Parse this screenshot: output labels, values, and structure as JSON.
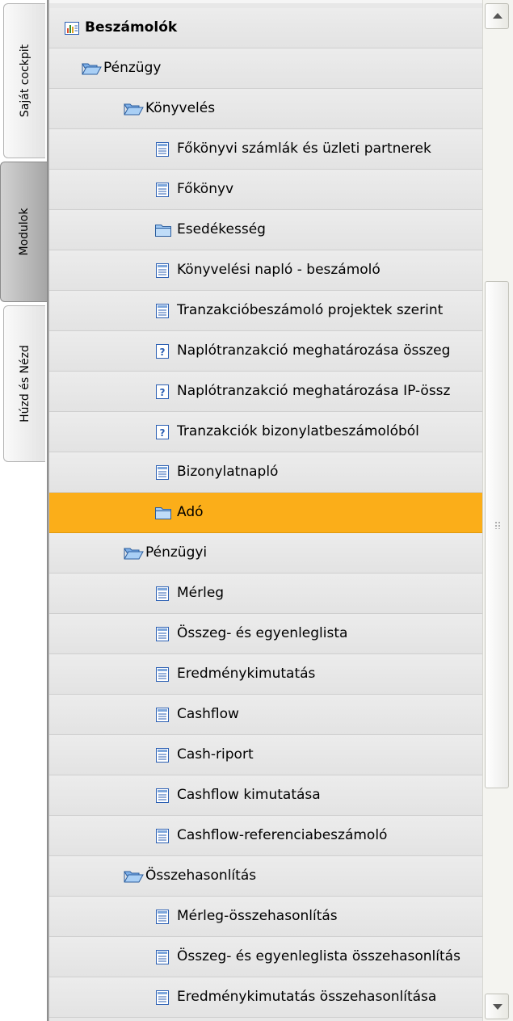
{
  "tabs": [
    {
      "label": "Saját cockpit"
    },
    {
      "label": "Modulok"
    },
    {
      "label": "Húzd és Nézd"
    }
  ],
  "tree": {
    "items": [
      {
        "label": "Beszámolók",
        "icon": "report-chart-icon"
      },
      {
        "label": "Pénzügy",
        "icon": "folder-open-icon"
      },
      {
        "label": "Könyvelés",
        "icon": "folder-open-icon"
      },
      {
        "label": "Főkönyvi számlák és üzleti partnerek",
        "icon": "report-document-icon"
      },
      {
        "label": "Főkönyv",
        "icon": "report-document-icon"
      },
      {
        "label": "Esedékesség",
        "icon": "folder-closed-icon"
      },
      {
        "label": "Könyvelési napló - beszámoló",
        "icon": "report-document-icon"
      },
      {
        "label": "Tranzakcióbeszámoló projektek szerint",
        "icon": "report-document-icon"
      },
      {
        "label": "Naplótranzakció meghatározása összeg",
        "icon": "query-document-icon"
      },
      {
        "label": "Naplótranzakció meghatározása IP-össz",
        "icon": "query-document-icon"
      },
      {
        "label": "Tranzakciók bizonylatbeszámolóból",
        "icon": "query-document-icon"
      },
      {
        "label": "Bizonylatnapló",
        "icon": "report-document-icon"
      },
      {
        "label": "Adó",
        "icon": "folder-closed-icon"
      },
      {
        "label": "Pénzügyi",
        "icon": "folder-open-icon"
      },
      {
        "label": "Mérleg",
        "icon": "report-document-icon"
      },
      {
        "label": "Összeg- és egyenleglista",
        "icon": "report-document-icon"
      },
      {
        "label": "Eredménykimutatás",
        "icon": "report-document-icon"
      },
      {
        "label": "Cashflow",
        "icon": "report-document-icon"
      },
      {
        "label": "Cash-riport",
        "icon": "report-document-icon"
      },
      {
        "label": "Cashflow kimutatása",
        "icon": "report-document-icon"
      },
      {
        "label": "Cashflow-referenciabeszámoló",
        "icon": "report-document-icon"
      },
      {
        "label": "Összehasonlítás",
        "icon": "folder-open-icon"
      },
      {
        "label": "Mérleg-összehasonlítás",
        "icon": "report-document-icon"
      },
      {
        "label": "Összeg- és egyenleglista összehasonlítás",
        "icon": "report-document-icon"
      },
      {
        "label": "Eredménykimutatás összehasonlítása",
        "icon": "report-document-icon"
      }
    ]
  },
  "colors": {
    "selected_row": "#fbae19",
    "row_bg": "#e7e7e7"
  }
}
